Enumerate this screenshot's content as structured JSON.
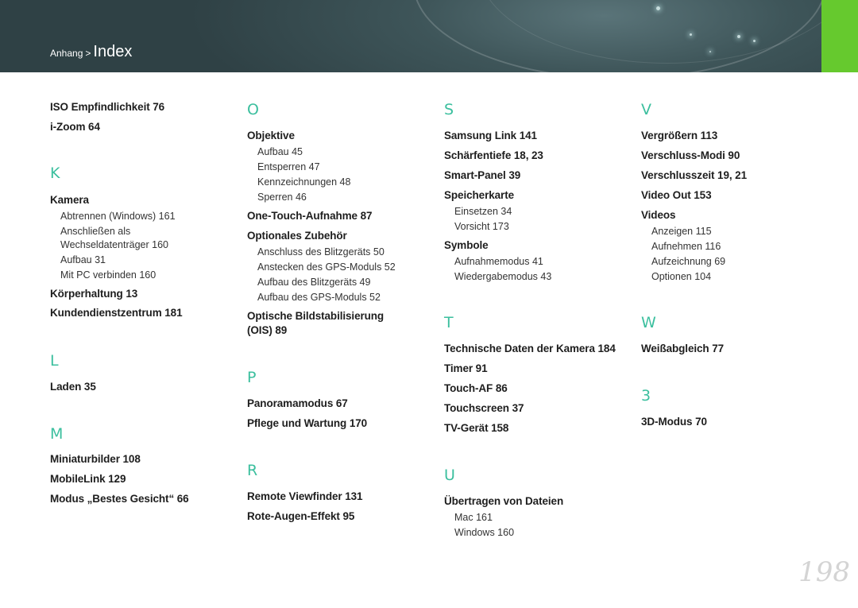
{
  "header": {
    "breadcrumb_parent": "Anhang",
    "breadcrumb_separator": ">",
    "breadcrumb_current": "Index"
  },
  "columns": {
    "c1": {
      "i1": "ISO Empfindlichkeit  76",
      "i2": "i-Zoom  64",
      "kL": "K",
      "k1": "Kamera",
      "k1a": "Abtrennen (Windows)  161",
      "k1b": "Anschließen als",
      "k1c": "Wechseldatenträger  160",
      "k1d": "Aufbau  31",
      "k1e": "Mit PC verbinden  160",
      "k2": "Körperhaltung  13",
      "k3": "Kundendienstzentrum  181",
      "lL": "L",
      "l1": "Laden  35",
      "mL": "M",
      "m1": "Miniaturbilder  108",
      "m2": "MobileLink  129",
      "m3": "Modus „Bestes Gesicht“  66"
    },
    "c2": {
      "oL": "O",
      "o1": "Objektive",
      "o1a": "Aufbau  45",
      "o1b": "Entsperren  47",
      "o1c": "Kennzeichnungen  48",
      "o1d": "Sperren  46",
      "o2": "One-Touch-Aufnahme  87",
      "o3": "Optionales Zubehör",
      "o3a": "Anschluss des Blitzgeräts  50",
      "o3b": "Anstecken des GPS-Moduls  52",
      "o3c": "Aufbau des Blitzgeräts  49",
      "o3d": "Aufbau des GPS-Moduls  52",
      "o4a": "Optische Bildstabilisierung",
      "o4b": "(OIS)  89",
      "pL": "P",
      "p1": "Panoramamodus  67",
      "p2": "Pflege und Wartung  170",
      "rL": "R",
      "r1": "Remote Viewfinder  131",
      "r2": "Rote-Augen-Effekt  95"
    },
    "c3": {
      "sL": "S",
      "s1": "Samsung Link  141",
      "s2": "Schärfentiefe  18, 23",
      "s3": "Smart-Panel  39",
      "s4": "Speicherkarte",
      "s4a": "Einsetzen  34",
      "s4b": "Vorsicht  173",
      "s5": "Symbole",
      "s5a": "Aufnahmemodus  41",
      "s5b": "Wiedergabemodus  43",
      "tL": "T",
      "t1": "Technische Daten der Kamera  184",
      "t2": "Timer  91",
      "t3": "Touch-AF  86",
      "t4": "Touchscreen  37",
      "t5": "TV-Gerät  158",
      "uL": "U",
      "u1": "Übertragen von Dateien",
      "u1a": "Mac  161",
      "u1b": "Windows  160"
    },
    "c4": {
      "vL": "V",
      "v1": "Vergrößern  113",
      "v2": "Verschluss-Modi  90",
      "v3": "Verschlusszeit  19, 21",
      "v4": "Video Out  153",
      "v5": "Videos",
      "v5a": "Anzeigen  115",
      "v5b": "Aufnehmen  116",
      "v5c": "Aufzeichnung  69",
      "v5d": "Optionen  104",
      "wL": "W",
      "w1": "Weißabgleich  77",
      "nL": "3",
      "n1": "3D-Modus  70"
    }
  },
  "page_number": "198",
  "colors": {
    "accent": "#3bbf9e",
    "header": "#3e5559",
    "tab": "#66c92e"
  }
}
